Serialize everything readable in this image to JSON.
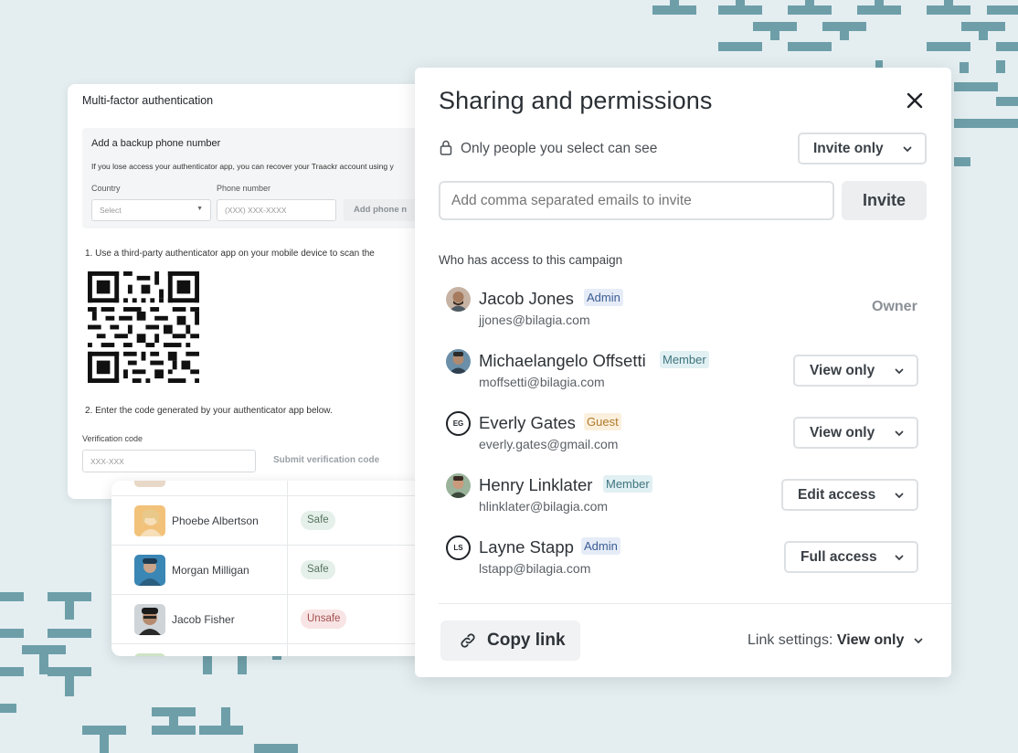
{
  "mfa": {
    "title": "Multi-factor authentication",
    "backup_title": "Add a backup phone number",
    "backup_desc": "If you lose access your authenticator app, you can recover your Traackr account using y",
    "country_label": "Country",
    "country_value": "Select",
    "phone_label": "Phone number",
    "phone_placeholder": "(XXX) XXX-XXXX",
    "add_phone_button": "Add phone n",
    "step1_text": "1. Use a third-party authenticator app on your mobile device to scan the",
    "step2_text": "2. Enter the code generated by your authenticator app below.",
    "verification_label": "Verification code",
    "verification_placeholder": "XXX-XXX",
    "submit_button": "Submit verification code"
  },
  "people_list": {
    "rows": [
      {
        "name": "Phoebe Albertson",
        "status": "Safe"
      },
      {
        "name": "Morgan Milligan",
        "status": "Safe"
      },
      {
        "name": "Jacob Fisher",
        "status": "Unsafe"
      }
    ]
  },
  "sharing": {
    "title": "Sharing and permissions",
    "visibility_text": "Only people you select can see",
    "visibility_dropdown": "Invite only",
    "email_placeholder": "Add comma separated emails to invite",
    "invite_button": "Invite",
    "access_heading": "Who has access to this campaign",
    "members": [
      {
        "name": "Jacob Jones",
        "role": "Admin",
        "email": "jjones@bilagia.com",
        "permission": "Owner",
        "initials": ""
      },
      {
        "name": "Michaelangelo Offsetti",
        "role": "Member",
        "email": "moffsetti@bilagia.com",
        "permission": "View only",
        "initials": ""
      },
      {
        "name": "Everly Gates",
        "role": "Guest",
        "email": "everly.gates@gmail.com",
        "permission": "View only",
        "initials": "EG"
      },
      {
        "name": "Henry Linklater",
        "role": "Member",
        "email": "hlinklater@bilagia.com",
        "permission": "Edit access",
        "initials": ""
      },
      {
        "name": "Layne Stapp",
        "role": "Admin",
        "email": "lstapp@bilagia.com",
        "permission": "Full access",
        "initials": "LS"
      }
    ],
    "copy_link_label": "Copy link",
    "link_settings_label": "Link settings:",
    "link_settings_value": "View only"
  },
  "icons": {
    "close": "close-icon",
    "lock": "lock-icon",
    "chevron": "chevron-down-icon",
    "link": "link-icon"
  },
  "colors": {
    "background": "#e4eef1",
    "decor": "#6e9fa9",
    "admin_badge": "#3b5c93",
    "member_badge": "#3f7480",
    "guest_badge": "#b07a2a",
    "safe_badge": "#55745f",
    "unsafe_badge": "#a45050"
  }
}
